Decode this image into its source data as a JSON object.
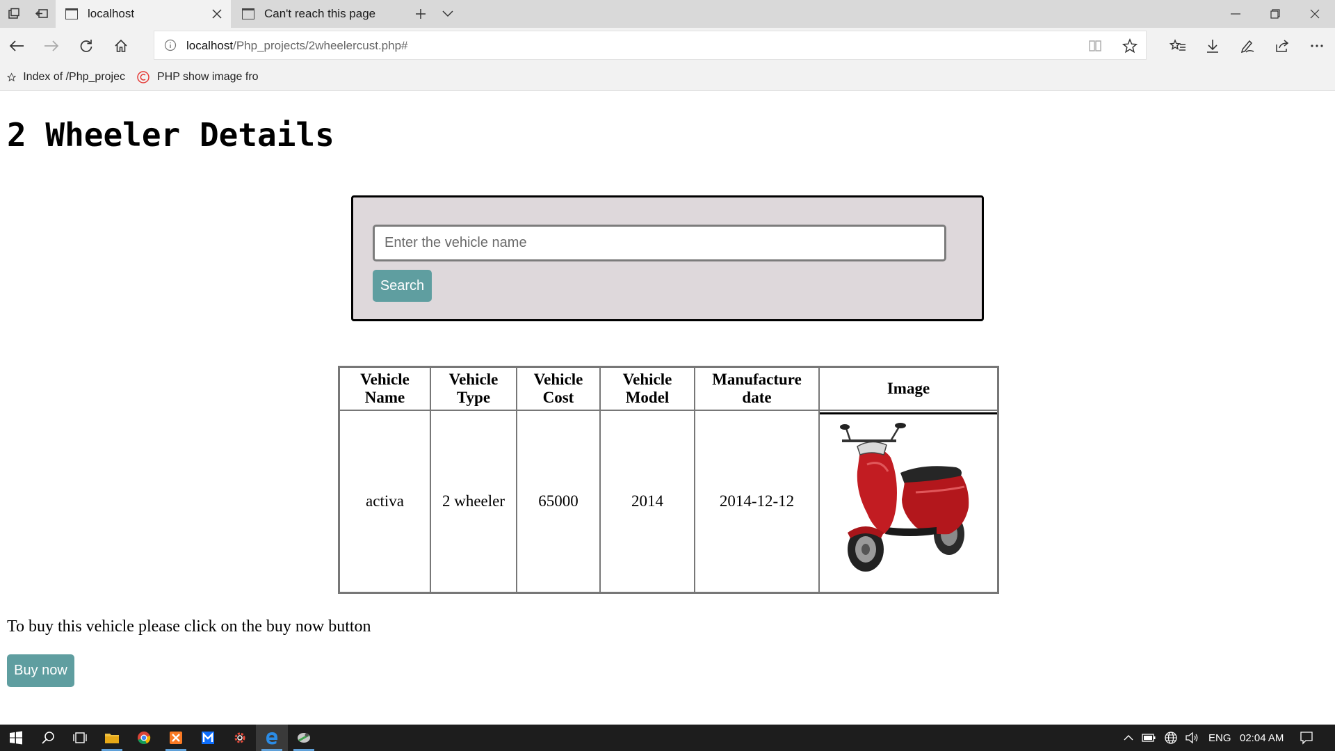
{
  "browser": {
    "tabs": [
      {
        "label": "localhost",
        "active": true
      },
      {
        "label": "Can't reach this page",
        "active": false
      }
    ],
    "url": {
      "host": "localhost",
      "path": "/Php_projects/2wheelercust.php#"
    },
    "favorites": [
      {
        "label": "Index of /Php_projec"
      },
      {
        "label": "PHP show image fro"
      }
    ]
  },
  "page": {
    "title": "2 Wheeler Details",
    "search": {
      "placeholder": "Enter the vehicle name",
      "button_label": "Search"
    },
    "table": {
      "headers": {
        "name": [
          "Vehicle",
          "Name"
        ],
        "type": [
          "Vehicle",
          "Type"
        ],
        "cost": [
          "Vehicle",
          "Cost"
        ],
        "model": [
          "Vehicle",
          "Model"
        ],
        "date": [
          "Manufacture",
          "date"
        ],
        "image": "Image"
      },
      "rows": [
        {
          "name": "activa",
          "type": "2 wheeler",
          "cost": "65000",
          "model": "2014",
          "date": "2014-12-12",
          "image": "red-scooter-photo"
        }
      ]
    },
    "buy_text": "To buy this vehicle please click on the buy now button",
    "buy_button_label": "Buy now"
  },
  "colors": {
    "button": "#5f9ea0",
    "search_box_bg": "#ded8db",
    "scooter_red": "#b3171c"
  },
  "taskbar": {
    "language": "ENG",
    "clock": "02:04 AM",
    "apps": [
      "file-explorer",
      "chrome",
      "xampp",
      "malwarebytes",
      "settings-gear",
      "edge",
      "tool"
    ]
  }
}
